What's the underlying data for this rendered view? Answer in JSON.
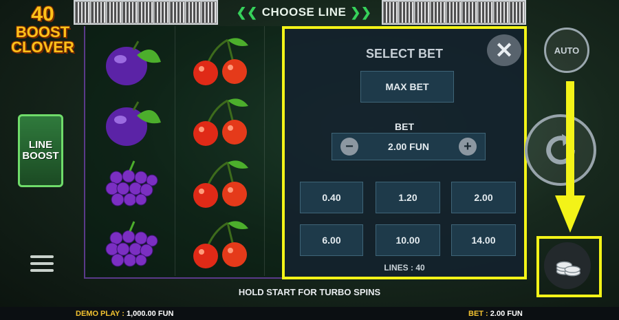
{
  "header": {
    "choose_line_label": "CHOOSE LINE",
    "chevron_left": "❮❮",
    "chevron_right": "❯❯"
  },
  "logo": {
    "line1": "40",
    "line2": "BOOST",
    "line3": "CLOVER"
  },
  "line_boost": {
    "line1": "LINE",
    "line2": "BOOST"
  },
  "reels": {
    "col1": [
      "plum",
      "plum",
      "grapes",
      "grapes"
    ],
    "col2": [
      "cherries",
      "cherries",
      "cherries",
      "cherries"
    ]
  },
  "bet_panel": {
    "title": "SELECT BET",
    "close_glyph": "✕",
    "max_bet_label": "MAX BET",
    "bet_label": "BET",
    "minus_glyph": "−",
    "plus_glyph": "+",
    "current_bet": "2.00 FUN",
    "options": [
      "0.40",
      "1.20",
      "2.00",
      "6.00",
      "10.00",
      "14.00"
    ],
    "lines_text": "LINES : 40"
  },
  "controls": {
    "auto_label": "AUTO"
  },
  "hint": "HOLD START FOR TURBO SPINS",
  "footer": {
    "demo_label": "DEMO PLAY :",
    "demo_value": "1,000.00 FUN",
    "bet_label": "BET :",
    "bet_value": "2.00 FUN"
  },
  "colors": {
    "highlight": "#f3f318",
    "accent_green": "#36d15a",
    "gold": "#f2c230"
  }
}
